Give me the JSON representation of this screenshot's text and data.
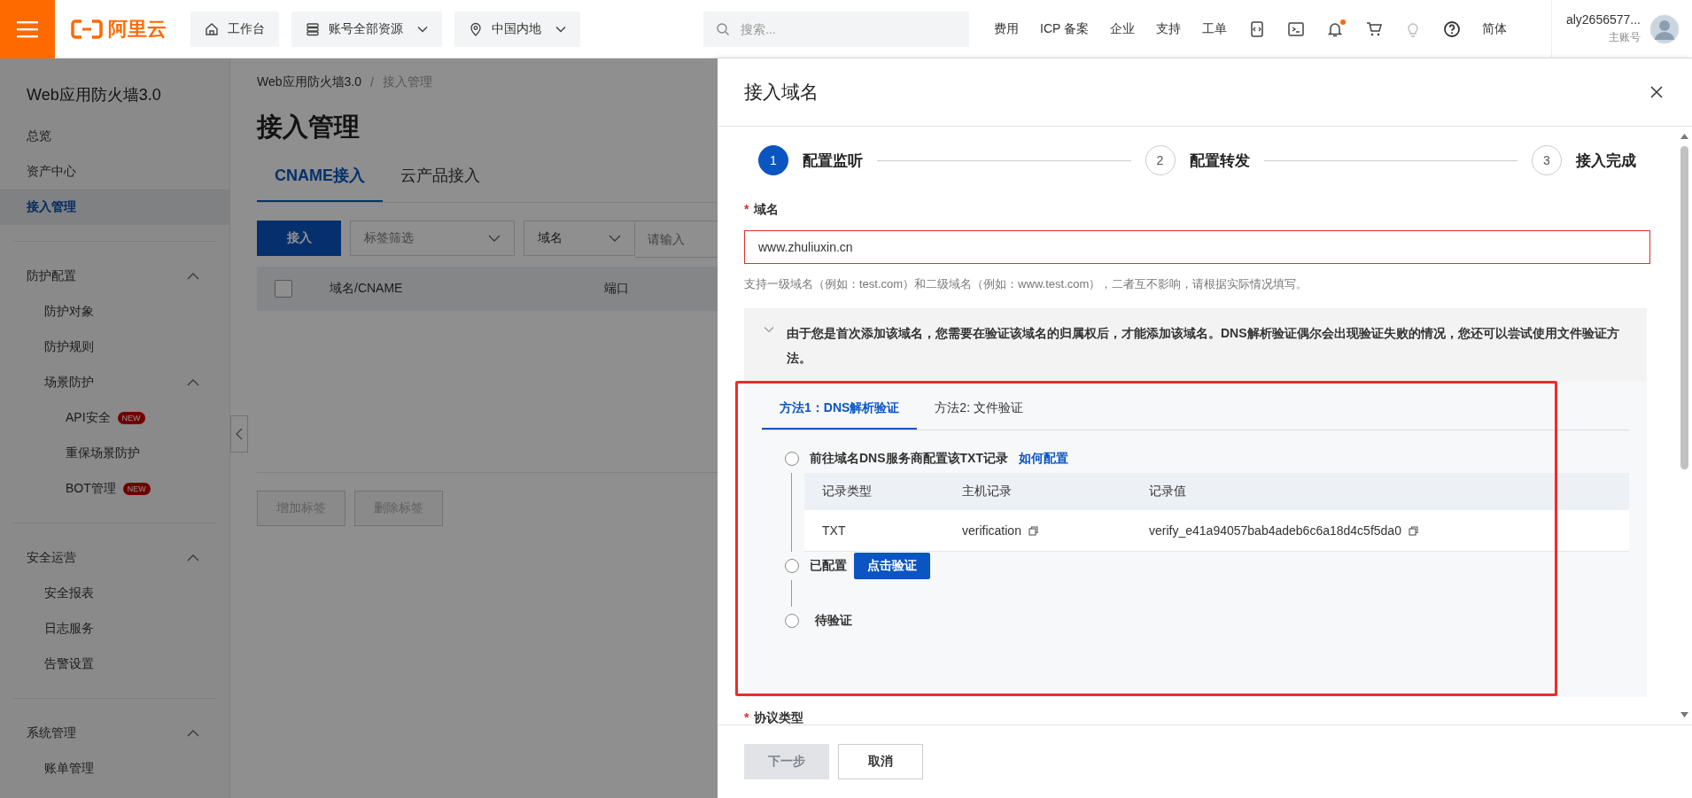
{
  "topbar": {
    "logo": "阿里云",
    "nav": [
      {
        "kind": "home",
        "label": "工作台"
      },
      {
        "kind": "resources",
        "label": "账号全部资源"
      },
      {
        "kind": "region",
        "label": "中国内地"
      }
    ],
    "search": {
      "placeholder": "搜索..."
    },
    "links": [
      "费用",
      "ICP 备案",
      "企业",
      "支持",
      "工单"
    ],
    "has_unread": true,
    "language": "简体",
    "account": {
      "name": "aly2656577...",
      "role": "主账号"
    }
  },
  "sidebar": {
    "title": "Web应用防火墙3.0",
    "items": [
      {
        "label": "总览",
        "selected": false
      },
      {
        "label": "资产中心",
        "selected": false
      },
      {
        "label": "接入管理",
        "selected": true
      }
    ],
    "groups": [
      {
        "label": "防护配置",
        "expanded": true,
        "children": [
          {
            "label": "防护对象",
            "selected": false
          },
          {
            "label": "防护规则",
            "selected": false
          },
          {
            "label": "场景防护",
            "selected": false,
            "expanded": true,
            "children": [
              {
                "label": "API安全",
                "selected": false,
                "badge": "NEW"
              },
              {
                "label": "重保场景防护",
                "selected": false
              },
              {
                "label": "BOT管理",
                "selected": false,
                "badge": "NEW"
              }
            ]
          }
        ]
      },
      {
        "label": "安全运营",
        "expanded": true,
        "children": [
          {
            "label": "安全报表",
            "selected": false
          },
          {
            "label": "日志服务",
            "selected": false
          },
          {
            "label": "告警设置",
            "selected": false
          }
        ]
      },
      {
        "label": "系统管理",
        "expanded": true,
        "children": [
          {
            "label": "账单管理",
            "selected": false
          }
        ]
      }
    ]
  },
  "main": {
    "breadcrumb": [
      "Web应用防火墙3.0",
      "接入管理"
    ],
    "breadcrumb_separator": "/",
    "title": "接入管理",
    "tabs": [
      {
        "label": "CNAME接入",
        "selected": true
      },
      {
        "label": "云产品接入",
        "selected": false
      }
    ],
    "add_button": "接入",
    "tag_filter": {
      "placeholder": "标签筛选"
    },
    "search_field": {
      "selected": "域名",
      "placeholder": "请输入"
    },
    "table": {
      "all_checked": false,
      "columns": [
        "域名/CNAME",
        "端口"
      ]
    },
    "bottom_buttons": [
      {
        "label": "增加标签",
        "disabled": true
      },
      {
        "label": "删除标签",
        "disabled": true
      }
    ]
  },
  "drawer": {
    "title": "接入域名",
    "steps": [
      {
        "number": "1",
        "label": "配置监听",
        "selected": true
      },
      {
        "number": "2",
        "label": "配置转发",
        "selected": false
      },
      {
        "number": "3",
        "label": "接入完成",
        "selected": false
      }
    ],
    "domain_field": {
      "label": "域名",
      "required_mark": "*",
      "value": "www.zhuliuxin.cn",
      "error": true
    },
    "hint": "支持一级域名（例如：test.com）和二级域名（例如：www.test.com），二者互不影响，请根据实际情况填写。",
    "notice": {
      "expanded": true,
      "text": "由于您是首次添加该域名，您需要在验证该域名的归属权后，才能添加该域名。DNS解析验证偶尔会出现验证失败的情况，您还可以尝试使用文件验证方法。"
    },
    "method_tabs": [
      {
        "label": "方法1：DNS解析验证",
        "selected": true
      },
      {
        "label": "方法2: 文件验证",
        "selected": false
      }
    ],
    "verify_steps": [
      {
        "kind": "instruction",
        "label": "前往域名DNS服务商配置该TXT记录",
        "link": "如何配置",
        "checked": false,
        "table": {
          "columns": [
            "记录类型",
            "主机记录",
            "记录值"
          ],
          "rows": [
            [
              "TXT",
              "verification",
              "verify_e41a94057bab4adeb6c6a18d4c5f5da0"
            ]
          ]
        }
      },
      {
        "kind": "action",
        "label": "已配置",
        "button": "点击验证",
        "checked": false
      },
      {
        "kind": "status",
        "label": "待验证",
        "checked": false
      }
    ],
    "next_field": {
      "label": "协议类型",
      "required_mark": "*"
    },
    "footer_buttons": [
      {
        "label": "下一步",
        "disabled": true
      },
      {
        "label": "取消",
        "disabled": false
      }
    ]
  }
}
